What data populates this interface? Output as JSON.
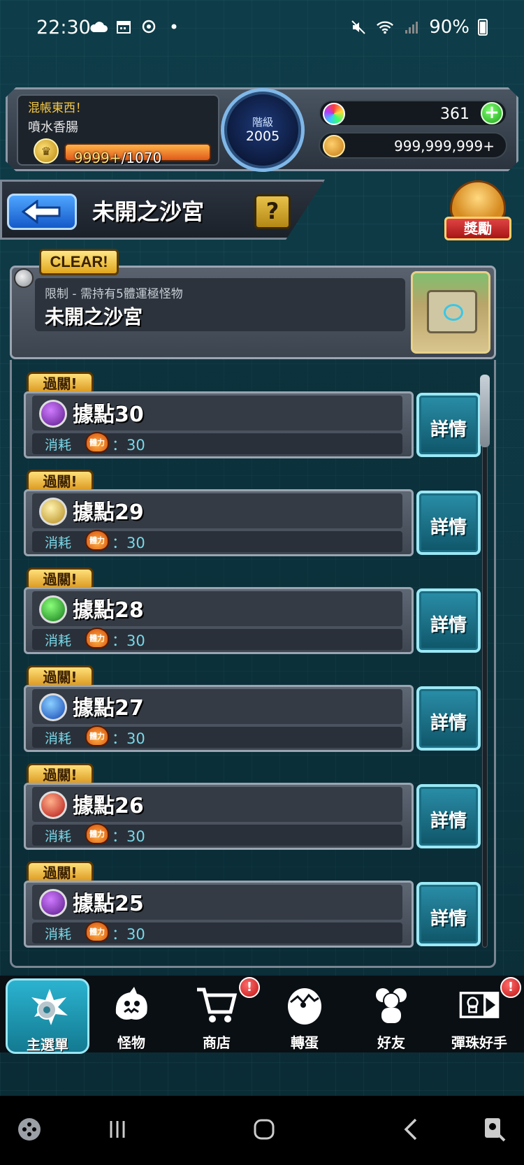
{
  "status_bar": {
    "time": "22:30",
    "battery": "90%",
    "icons_left": [
      "cloud-icon",
      "calendar-icon",
      "sync-icon",
      "dot-icon"
    ],
    "icons_right": [
      "mute-icon",
      "wifi-icon",
      "signal-icon",
      "battery-icon"
    ]
  },
  "player": {
    "title": "混帳東西！",
    "name": "噴水香腸",
    "stamina_current": "9999+",
    "stamina_max": "/1070",
    "rank_label": "階級",
    "rank_value": "2005",
    "gems": "361",
    "gold": "999,999,999+"
  },
  "header": {
    "title": "未開之沙宮",
    "help_label": "?",
    "reward_label": "獎勵"
  },
  "stage": {
    "clear_label": "CLEAR!",
    "restriction": "限制 - 需持有5體運極怪物",
    "name": "未開之沙宮"
  },
  "levels": [
    {
      "pass": "過關!",
      "name": "據點30",
      "element": "dark-element-icon",
      "cost_label": "消耗",
      "cost_icon_text": "體力",
      "cost": "：30",
      "detail": "詳情"
    },
    {
      "pass": "過關!",
      "name": "據點29",
      "element": "light-element-icon",
      "cost_label": "消耗",
      "cost_icon_text": "體力",
      "cost": "：30",
      "detail": "詳情"
    },
    {
      "pass": "過關!",
      "name": "據點28",
      "element": "wood-element-icon",
      "cost_label": "消耗",
      "cost_icon_text": "體力",
      "cost": "：30",
      "detail": "詳情"
    },
    {
      "pass": "過關!",
      "name": "據點27",
      "element": "water-element-icon",
      "cost_label": "消耗",
      "cost_icon_text": "體力",
      "cost": "：30",
      "detail": "詳情"
    },
    {
      "pass": "過關!",
      "name": "據點26",
      "element": "fire-element-icon",
      "cost_label": "消耗",
      "cost_icon_text": "體力",
      "cost": "：30",
      "detail": "詳情"
    },
    {
      "pass": "過關!",
      "name": "據點25",
      "element": "dark-element-icon",
      "cost_label": "消耗",
      "cost_icon_text": "體力",
      "cost": "：30",
      "detail": "詳情"
    }
  ],
  "bottom_nav": [
    {
      "label": "主選單",
      "icon": "main-menu-icon",
      "active": true,
      "alert": false
    },
    {
      "label": "怪物",
      "icon": "monster-icon",
      "active": false,
      "alert": false
    },
    {
      "label": "商店",
      "icon": "cart-icon",
      "active": false,
      "alert": true
    },
    {
      "label": "轉蛋",
      "icon": "egg-icon",
      "active": false,
      "alert": false
    },
    {
      "label": "好友",
      "icon": "friends-icon",
      "active": false,
      "alert": false
    },
    {
      "label": "彈珠好手",
      "icon": "card-icon",
      "active": false,
      "alert": true
    }
  ],
  "alert_mark": "!",
  "colors": {
    "accent_cyan": "#2bb3d0",
    "gold": "#e1a61c",
    "cost_text": "#78d7e8",
    "background": "#0c3440"
  }
}
